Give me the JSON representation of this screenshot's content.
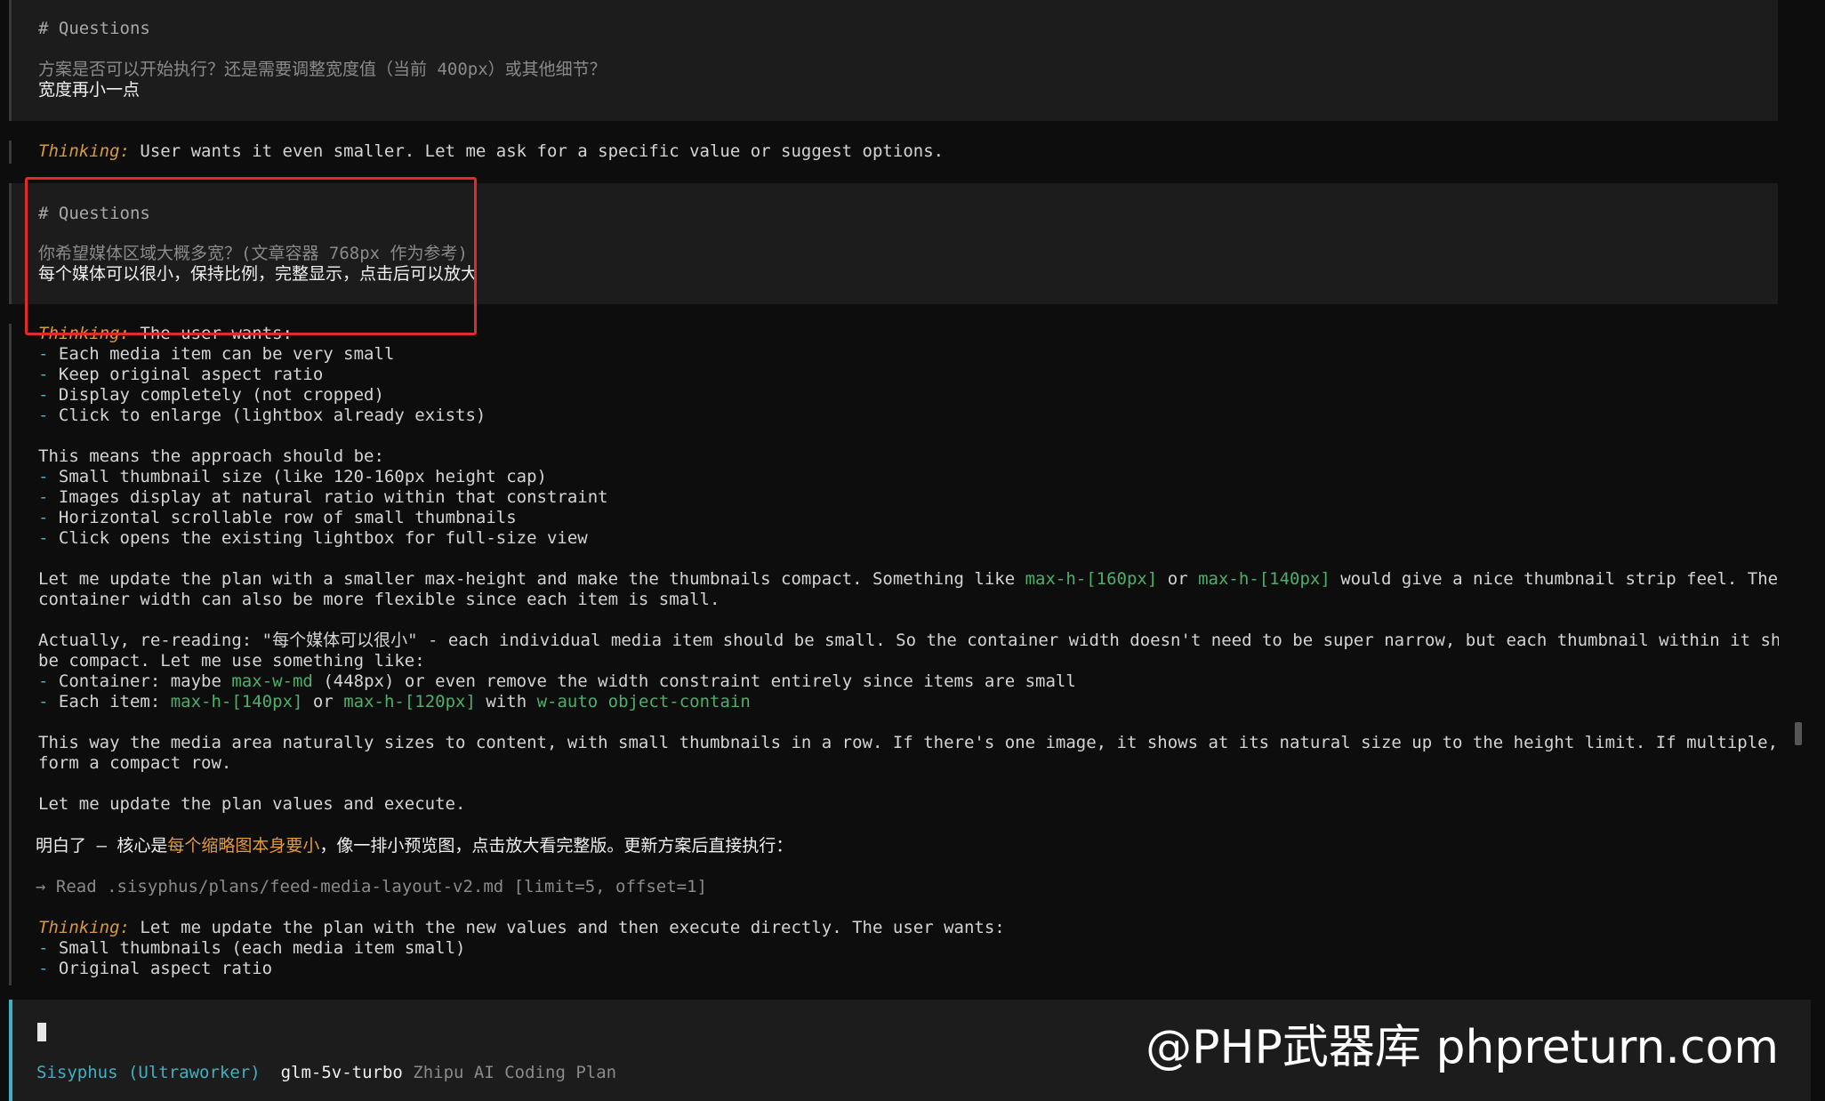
{
  "block1": {
    "heading": "# Questions",
    "question": "方案是否可以开始执行？还是需要调整宽度值（当前 400px）或其他细节？",
    "answer": "宽度再小一点"
  },
  "thinking1": {
    "label": "Thinking:",
    "text": " User wants it even smaller. Let me ask for a specific value or suggest options."
  },
  "block2": {
    "heading": "# Questions",
    "question": "你希望媒体区域大概多宽？(文章容器 768px 作为参考)",
    "answer": "每个媒体可以很小，保持比例，完整显示，点击后可以放大"
  },
  "thinking2": {
    "label": "Thinking:",
    "intro": " The user wants:",
    "bullets1": [
      "Each media item can be very small",
      "Keep original aspect ratio",
      "Display completely (not cropped)",
      "Click to enlarge (lightbox already exists)"
    ],
    "approach_intro": "This means the approach should be:",
    "bullets2": [
      "Small thumbnail size (like 120-160px height cap)",
      "Images display at natural ratio within that constraint",
      "Horizontal scrollable row of small thumbnails",
      "Click opens the existing lightbox for full-size view"
    ],
    "p1_a": "Let me update the plan with a smaller max-height and make the thumbnails compact. Something like ",
    "p1_code1": "max-h-[160px]",
    "p1_or": " or ",
    "p1_code2": "max-h-[140px]",
    "p1_b": " would give a nice thumbnail strip feel. The",
    "p1_line2": "container width can also be more flexible since each item is small.",
    "p2_line1": "Actually, re-reading: \"每个媒体可以很小\" - each individual media item should be small. So the container width doesn't need to be super narrow, but each thumbnail within it should",
    "p2_line2": "be compact. Let me use something like:",
    "container_a": "Container: maybe ",
    "container_code": "max-w-md",
    "container_b": " (448px) or even remove the width constraint entirely since items are small",
    "item_a": "Each item: ",
    "item_code1": "max-h-[140px]",
    "item_or": " or ",
    "item_code2": "max-h-[120px]",
    "item_with": " with ",
    "item_code3": "w-auto object-contain",
    "p3_line1": "This way the media area naturally sizes to content, with small thumbnails in a row. If there's one image, it shows at its natural size up to the height limit. If multiple, they",
    "p3_line2": "form a compact row.",
    "p4": "Let me update the plan values and execute."
  },
  "reply": {
    "a": "明白了 — 核心是",
    "highlight": "每个缩略图本身要小",
    "b": "，像一排小预览图，点击放大看完整版。更新方案后直接执行："
  },
  "tool_call": {
    "arrow": "→",
    "text": " Read .sisyphus/plans/feed-media-layout-v2.md [limit=5, offset=1]"
  },
  "thinking3": {
    "label": "Thinking:",
    "text": " Let me update the plan with the new values and then execute directly. The user wants:",
    "bullets": [
      "Small thumbnails (each media item small)",
      "Original aspect ratio"
    ]
  },
  "footer": {
    "agent": "Sisyphus (Ultraworker)",
    "model": "glm-5v-turbo",
    "provider": "Zhipu AI Coding Plan"
  },
  "watermark": "@PHP武器库 phpreturn.com",
  "colors": {
    "background": "#0d0d0d",
    "panel": "#1c1c1c",
    "thinking_label": "#d9993a",
    "code": "#4caf6a",
    "accent": "#3fb0c4",
    "highlight_box": "#e02b2b"
  }
}
